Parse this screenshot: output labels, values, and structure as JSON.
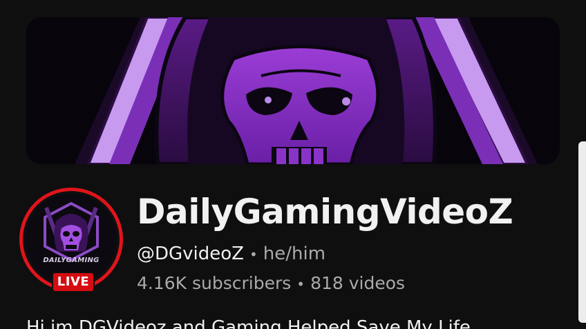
{
  "banner": {
    "image": "purple hooded skull reaper with crossed blades"
  },
  "avatar": {
    "brand_text": "DAILYGAMING",
    "live_label": "LIVE",
    "ring_color": "#e0141b"
  },
  "channel": {
    "name": "DailyGamingVideoZ",
    "handle": "@DGvideoZ",
    "separator": "•",
    "pronouns": "he/him",
    "subscribers": "4.16K subscribers",
    "videos": "818 videos",
    "description": "Hi im DGVideoz and Gaming Helped Save My Life"
  },
  "colors": {
    "background": "#0f0f0f",
    "accent_purple": "#8a2fc4",
    "live_red": "#d40d12",
    "text_primary": "#f1f1f1",
    "text_secondary": "#aaaaaa"
  }
}
